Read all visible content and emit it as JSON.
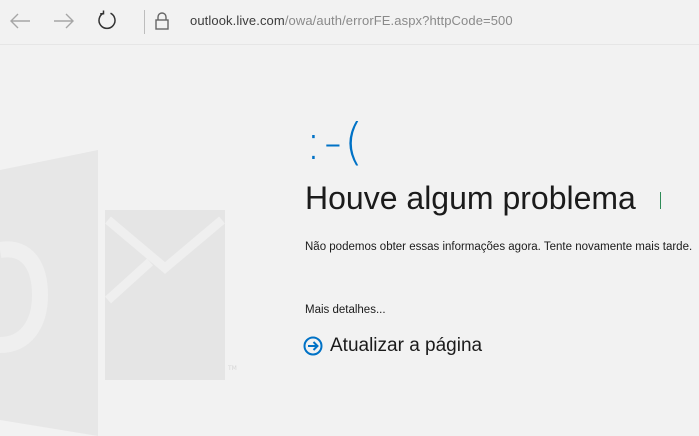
{
  "browser": {
    "url_host": "outlook.live.com",
    "url_path": "/owa/auth/errorFE.aspx?httpCode=500"
  },
  "error": {
    "emoticon": ":-(",
    "headline": "Houve algum problema",
    "message": "Não podemos obter essas informações agora. Tente novamente mais tarde.",
    "details_link": "Mais detalhes...",
    "refresh_label": "Atualizar a página"
  },
  "logo": {
    "trademark": "TM"
  },
  "colors": {
    "accent": "#0072c6",
    "background": "#f2f2f2",
    "logo_shape": "#e6e6e6",
    "logo_mark": "#ececec"
  },
  "icons": [
    "back-arrow-icon",
    "forward-arrow-icon",
    "refresh-icon",
    "lock-icon",
    "outlook-logo-icon",
    "arrow-circle-icon"
  ]
}
